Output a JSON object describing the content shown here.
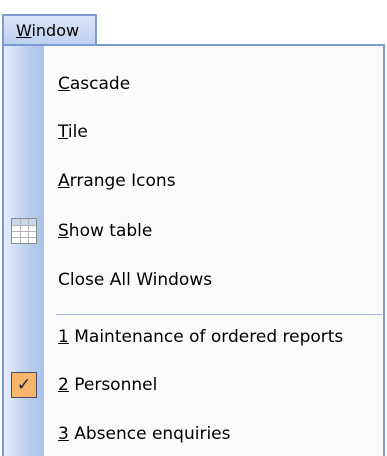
{
  "menu": {
    "title": "Window",
    "title_accel": "W",
    "title_rest": "indow"
  },
  "items": [
    {
      "accel": "C",
      "rest": "ascade",
      "icon": null
    },
    {
      "accel": "T",
      "rest": "ile",
      "icon": null
    },
    {
      "accel": "A",
      "rest": "rrange Icons",
      "icon": null
    },
    {
      "accel": "S",
      "rest": "how table",
      "icon": "table-icon"
    },
    {
      "accel": "",
      "rest": "Close All Windows",
      "icon": null
    }
  ],
  "windows": [
    {
      "accel": "1",
      "rest": " Maintenance of ordered reports",
      "checked": false
    },
    {
      "accel": "2",
      "rest": " Personnel",
      "checked": true,
      "check_glyph": "✓"
    },
    {
      "accel": "3",
      "rest": " Absence enquiries",
      "checked": false
    }
  ],
  "colors": {
    "menu_border": "#7b9bd1",
    "gutter": "#bdd0ef",
    "check_background": "#f6b66a"
  }
}
